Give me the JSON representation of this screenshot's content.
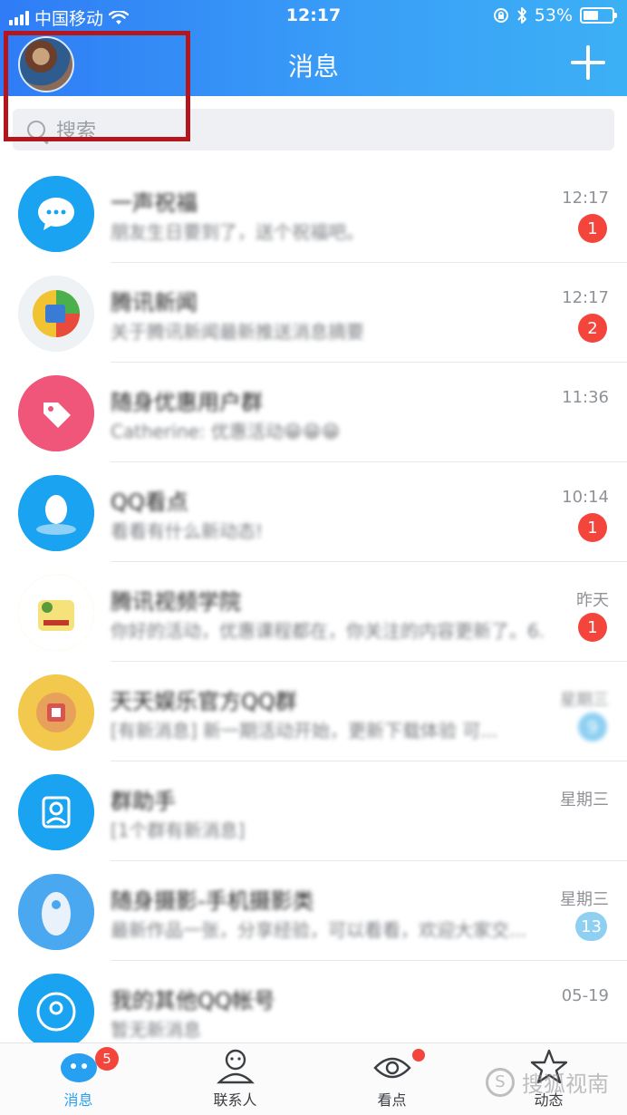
{
  "status_bar": {
    "carrier": "中国移动",
    "time": "12:17",
    "battery_percent": "53%",
    "battery_level": 0.53,
    "icons": [
      "signal-icon",
      "wifi-icon",
      "rotation-lock-icon",
      "bluetooth-icon",
      "battery-icon"
    ]
  },
  "header": {
    "title": "消息",
    "plus_icon": "plus-icon",
    "avatar": "user-avatar"
  },
  "search": {
    "placeholder": "搜索"
  },
  "conversations": [
    {
      "name": "一声祝福",
      "preview": "朋友生日要到了，送个祝福吧。",
      "time": "12:17",
      "badge": "1",
      "badge_style": "red",
      "avatar_color": "#1aa3f0",
      "avatar_icon": "chat-bubble-icon"
    },
    {
      "name": "腾讯新闻",
      "preview": "关于腾讯新闻最新推送消息摘要",
      "time": "12:17",
      "badge": "2",
      "badge_style": "red",
      "avatar_color": "#e8eef2",
      "avatar_icon": "news-icon"
    },
    {
      "name": "随身优惠用户群",
      "preview": "Catherine: 优惠活动😁😁😁",
      "time": "11:36",
      "badge": "",
      "badge_style": "",
      "avatar_color": "#f0557a",
      "avatar_icon": "tag-icon"
    },
    {
      "name": "QQ看点",
      "preview": "看看有什么新动态!",
      "time": "10:14",
      "badge": "1",
      "badge_style": "red",
      "avatar_color": "#1aa3f0",
      "avatar_icon": "qq-icon"
    },
    {
      "name": "腾讯视频学院",
      "preview": "你好的活动，优惠课程都在，你关注的内容更新了。6...",
      "time": "昨天",
      "badge": "1",
      "badge_style": "red",
      "avatar_color": "#f6e27a",
      "avatar_icon": "game-icon"
    },
    {
      "name": "天天娱乐官方QQ群",
      "preview": "[有新消息] 新一期活动开始，更新下载体验 可...",
      "time": "星期三",
      "badge": "9",
      "badge_style": "muted",
      "avatar_color": "#f2c94c",
      "avatar_icon": "group-icon"
    },
    {
      "name": "群助手",
      "preview": "[1个群有新消息]",
      "time": "星期三",
      "badge": "",
      "badge_style": "",
      "avatar_color": "#1aa3f0",
      "avatar_icon": "group-helper-icon"
    },
    {
      "name": "随身摄影-手机摄影类",
      "preview": "最新作品一张，分享经验，可以看看，欢迎大家交...",
      "time": "星期三",
      "badge": "13",
      "badge_style": "muted",
      "avatar_color": "#4aa8f0",
      "avatar_icon": "photo-group-icon"
    },
    {
      "name": "我的其他QQ帐号",
      "preview": "暂无新消息",
      "time": "05-19",
      "badge": "",
      "badge_style": "",
      "avatar_color": "#1aa3f0",
      "avatar_icon": "account-icon"
    }
  ],
  "bottom_nav": [
    {
      "label": "消息",
      "icon": "message-icon",
      "badge": "5",
      "active": true
    },
    {
      "label": "联系人",
      "icon": "contacts-icon",
      "badge": "",
      "active": false
    },
    {
      "label": "看点",
      "icon": "eye-icon",
      "badge": "dot",
      "active": false
    },
    {
      "label": "动态",
      "icon": "star-icon",
      "badge": "",
      "active": false
    }
  ],
  "watermark": {
    "text": "搜狐视南",
    "icon": "watermark-s-icon"
  },
  "colors": {
    "header_start": "#2f7cf6",
    "header_end": "#3cb0f5",
    "badge_red": "#f3453c",
    "badge_muted": "#8fd0f2",
    "highlight_box": "#b3161d",
    "active_tab": "#27a0f2"
  }
}
